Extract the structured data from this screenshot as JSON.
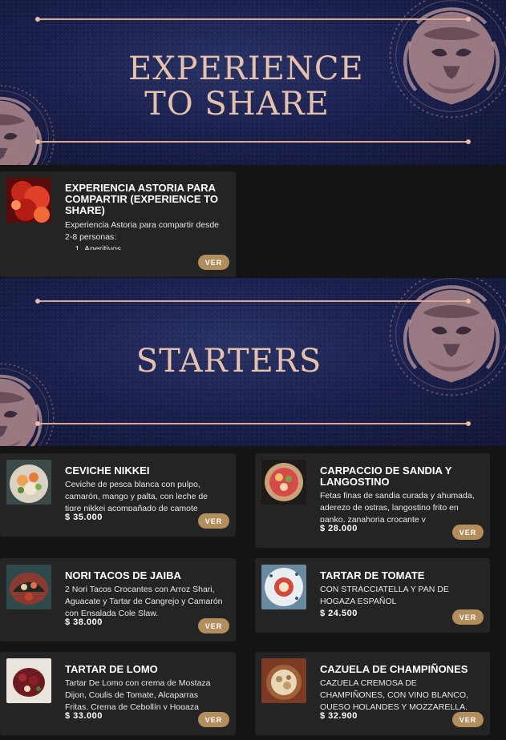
{
  "sections": [
    {
      "title": "EXPERIENCE TO SHARE"
    },
    {
      "title": "STARTERS"
    }
  ],
  "experience": {
    "name": "EXPERIENCIA ASTORIA PARA COMPARTIR (EXPERIENCE TO SHARE)",
    "desc": "Experiencia Astoria para compartir desde 2-8 personas:",
    "list_item": "Aperitivos.",
    "button": "VER"
  },
  "starters": [
    {
      "name": "CEVICHE NIKKEI",
      "desc": "Ceviche de pesca blanca con pulpo, camarón, mango y palta, con leche de tigre nikkei acompañado de camote",
      "price": "$ 35.000",
      "button": "VER"
    },
    {
      "name": "CARPACCIO DE SANDIA Y LANGOSTINO",
      "desc": "Fetas finas de sandia curada y ahumada, aderezo de ostras, langostino frito en panko, zanahoria crocante y",
      "price": "$ 28.000",
      "button": "VER"
    },
    {
      "name": "NORI TACOS DE JAIBA",
      "desc": "2 Nori Tacos Crocantes con Arroz Shari, Aguacate y Tartar de Cangrejo y Camarón con Ensalada Cole Slaw.",
      "price": "$ 38.000",
      "button": "VER"
    },
    {
      "name": "TARTAR DE TOMATE",
      "desc": "CON STRACCIATELLA Y PAN DE HOGAZA ESPAÑOL",
      "price": "$ 24.500",
      "button": "VER"
    },
    {
      "name": "TARTAR DE LOMO",
      "desc": "Tartar De Lomo con crema de Mostaza Dijon, Coulis de Tomate, Alcaparras Fritas, Crema de Cebollín y Hogaza",
      "price": "$ 33.000",
      "button": "VER"
    },
    {
      "name": "CAZUELA DE CHAMPIÑONES",
      "desc": "CAZUELA CREMOSA DE CHAMPIÑONES, CON VINO BLANCO, QUESO HOLANDES Y MOZZARELLA.",
      "price": "$ 32.900",
      "button": "VER"
    }
  ],
  "colors": {
    "accent": "#b38e5d",
    "banner_text": "#e6c2ad",
    "card_bg": "#242424"
  }
}
